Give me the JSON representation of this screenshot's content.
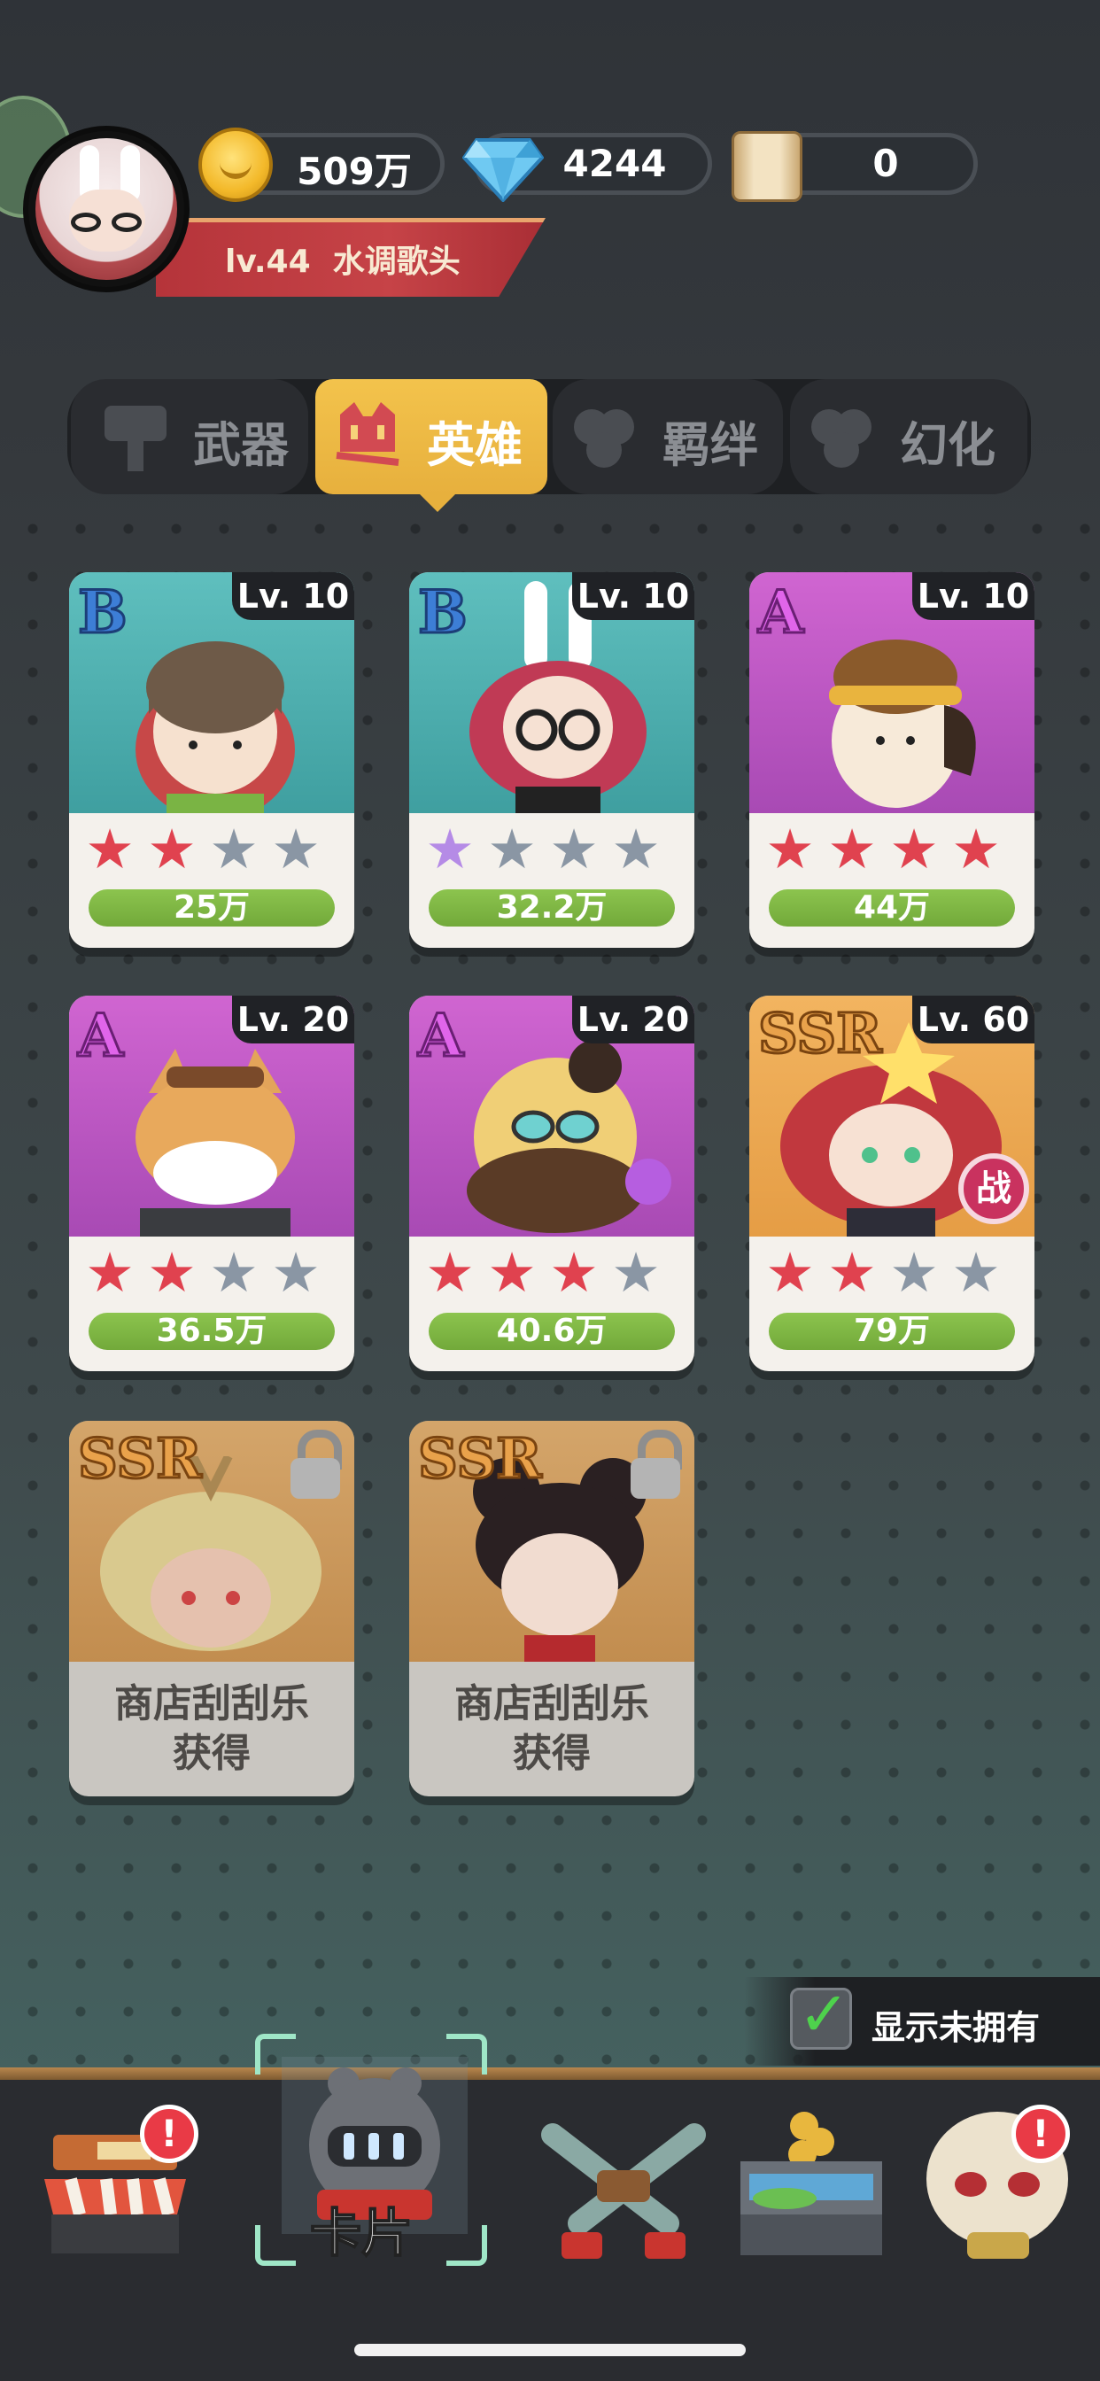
{
  "header": {
    "player_level": "lv.44",
    "player_name": "水调歌头",
    "currencies": [
      {
        "icon": "gold-coin-icon",
        "value": "509万"
      },
      {
        "icon": "diamond-icon",
        "value": "4244"
      },
      {
        "icon": "scroll-icon",
        "value": "0"
      }
    ]
  },
  "tabs": [
    {
      "label": "武器",
      "icon": "weapon-icon",
      "active": false
    },
    {
      "label": "英雄",
      "icon": "hero-icon",
      "active": true
    },
    {
      "label": "羁绊",
      "icon": "bond-icon",
      "active": false
    },
    {
      "label": "幻化",
      "icon": "transform-icon",
      "active": false
    }
  ],
  "cards": [
    {
      "rank": "B",
      "level": "Lv. 10",
      "stars_filled": 2,
      "stars_total": 4,
      "star_color": "red",
      "power": "25万",
      "bg": "teal"
    },
    {
      "rank": "B",
      "level": "Lv. 10",
      "stars_filled": 1,
      "stars_total": 4,
      "star_color": "purple",
      "power": "32.2万",
      "bg": "teal"
    },
    {
      "rank": "A",
      "level": "Lv. 10",
      "stars_filled": 4,
      "stars_total": 4,
      "star_color": "red",
      "power": "44万",
      "bg": "purple"
    },
    {
      "rank": "A",
      "level": "Lv. 20",
      "stars_filled": 2,
      "stars_total": 4,
      "star_color": "red",
      "power": "36.5万",
      "bg": "purple"
    },
    {
      "rank": "A",
      "level": "Lv. 20",
      "stars_filled": 3,
      "stars_total": 4,
      "star_color": "red",
      "power": "40.6万",
      "bg": "purple"
    },
    {
      "rank": "SSR",
      "level": "Lv. 60",
      "stars_filled": 2,
      "stars_total": 4,
      "star_color": "red",
      "power": "79万",
      "bg": "orange",
      "badge": "战"
    },
    {
      "rank": "SSR",
      "locked": true,
      "obtain_line1": "商店刮刮乐",
      "obtain_line2": "获得",
      "bg": "locked-orange"
    },
    {
      "rank": "SSR",
      "locked": true,
      "obtain_line1": "商店刮刮乐",
      "obtain_line2": "获得",
      "bg": "locked-orange"
    }
  ],
  "show_unowned": {
    "label": "显示未拥有",
    "checked": true
  },
  "nav": {
    "items": [
      {
        "icon": "shop-icon",
        "badge": "!"
      },
      {
        "icon": "knight-helmet-icon",
        "label": "卡片",
        "selected": true
      },
      {
        "icon": "crossed-guns-icon"
      },
      {
        "icon": "treasure-chest-icon"
      },
      {
        "icon": "skull-icon",
        "badge": "!"
      }
    ]
  },
  "colors": {
    "active_tab": "#e7b03d",
    "power_bar": "#7ab444",
    "star_red": "#e0424f",
    "star_grey": "#8a96a4",
    "badge_red": "#e93a46"
  }
}
